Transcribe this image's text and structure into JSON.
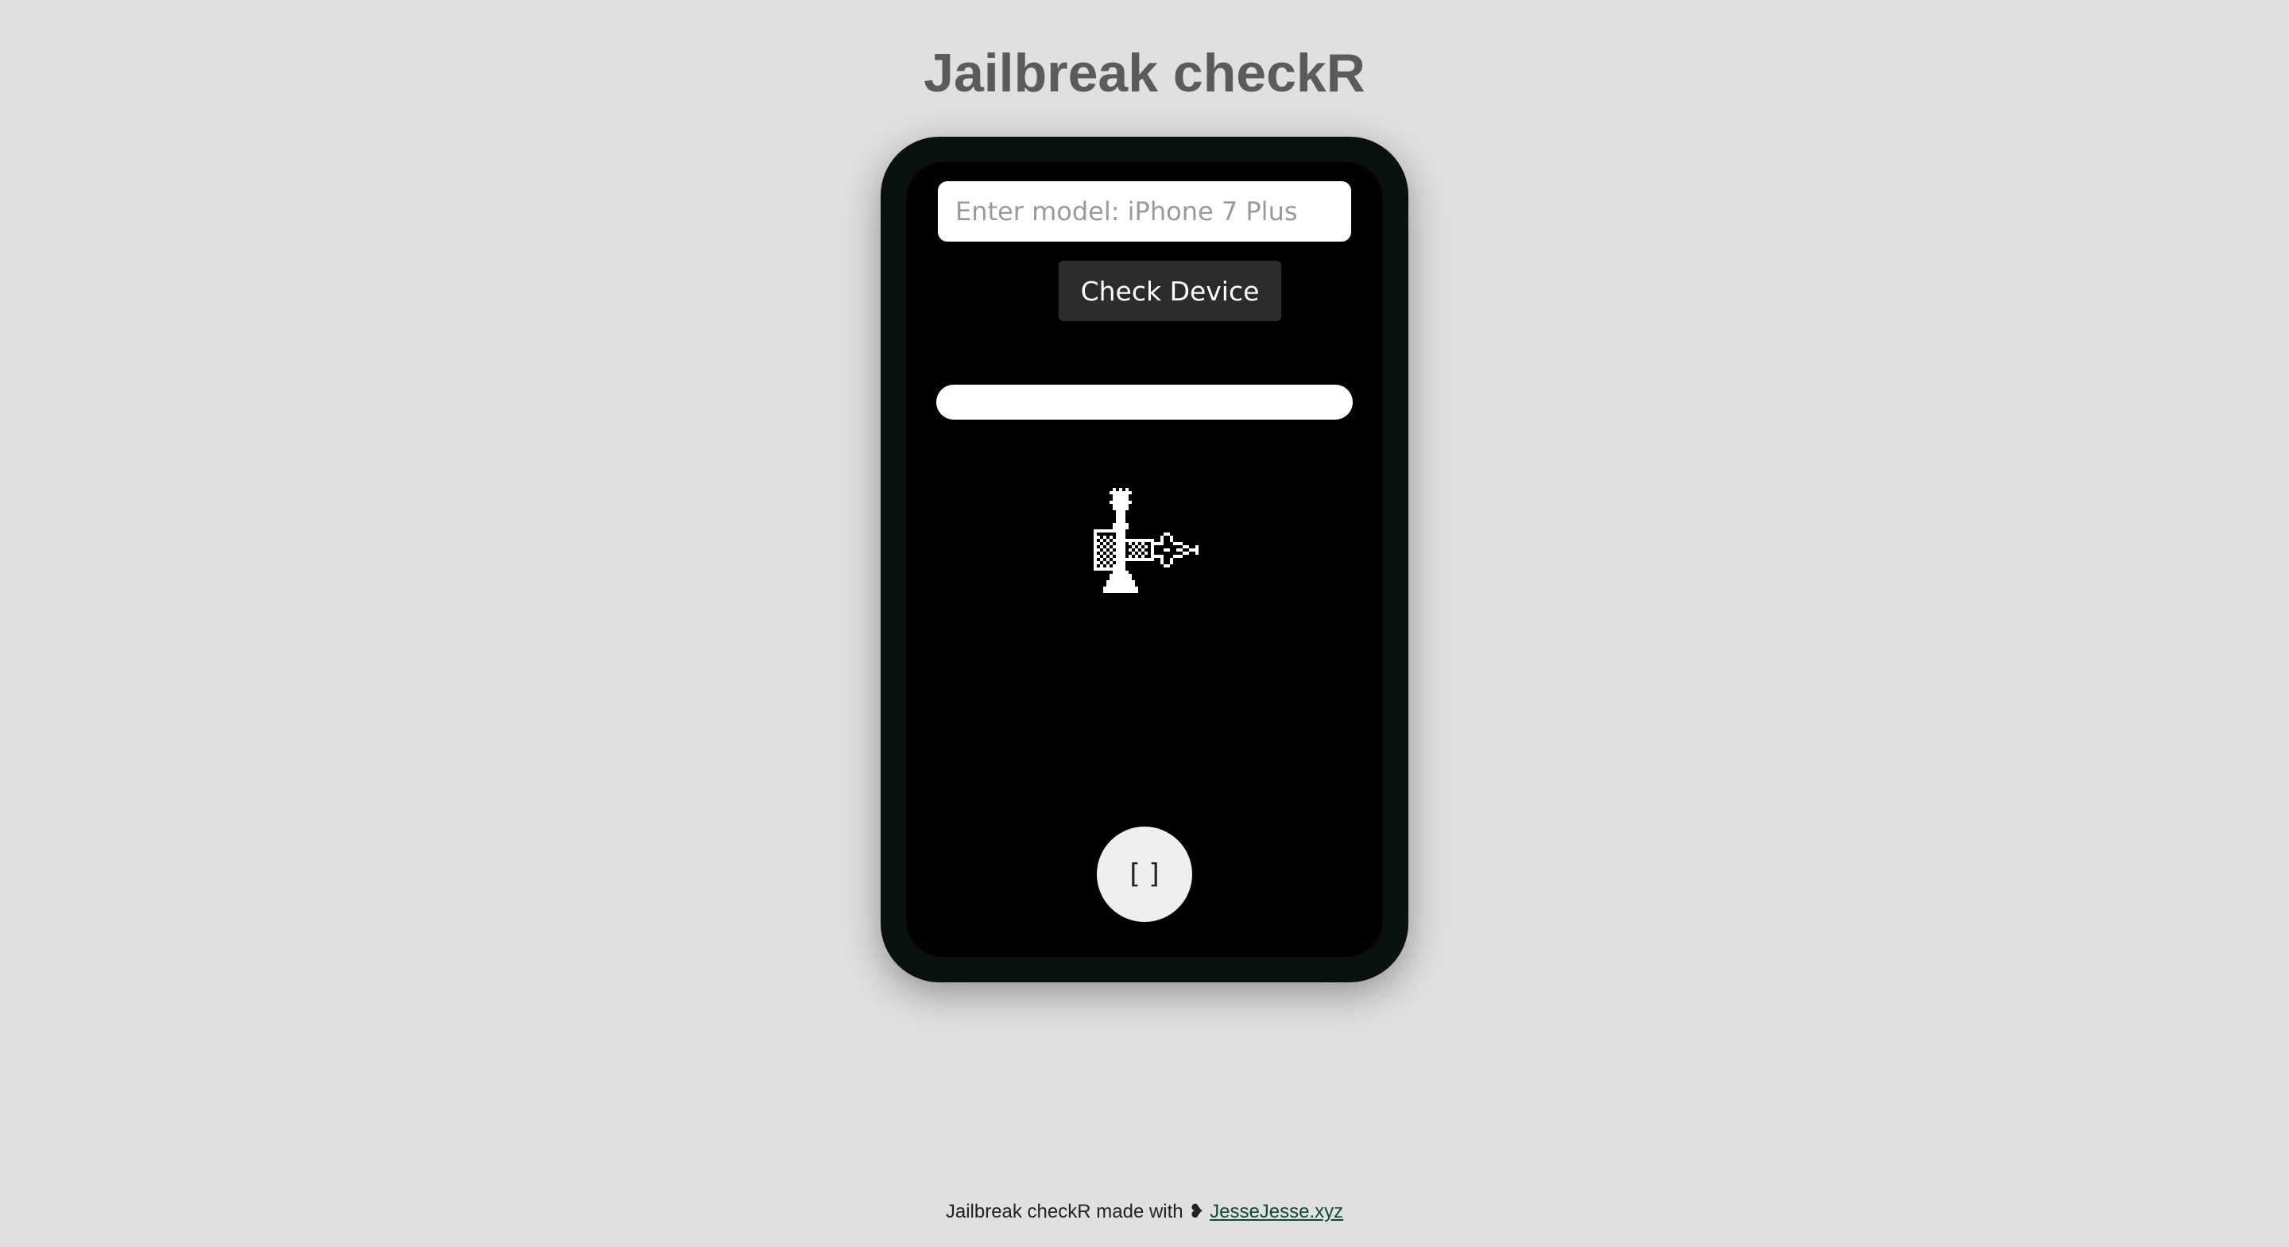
{
  "header": {
    "title": "Jailbreak checkR"
  },
  "device": {
    "model_input": {
      "value": "",
      "placeholder": "Enter model: iPhone 7 Plus"
    },
    "check_button_label": "Check Device",
    "result_text": "",
    "logo_icon": "checkra1n-chess-rook-logo",
    "home_button_label": "[ ]"
  },
  "footer": {
    "text": "Jailbreak checkR made with",
    "heart": "❥",
    "link_label": "JesseJesse.xyz"
  },
  "colors": {
    "background": "#e0e0e0",
    "title": "#5b5b5b",
    "phone_frame": "#071210",
    "screen": "#000000",
    "button": "#2c2c2c"
  }
}
